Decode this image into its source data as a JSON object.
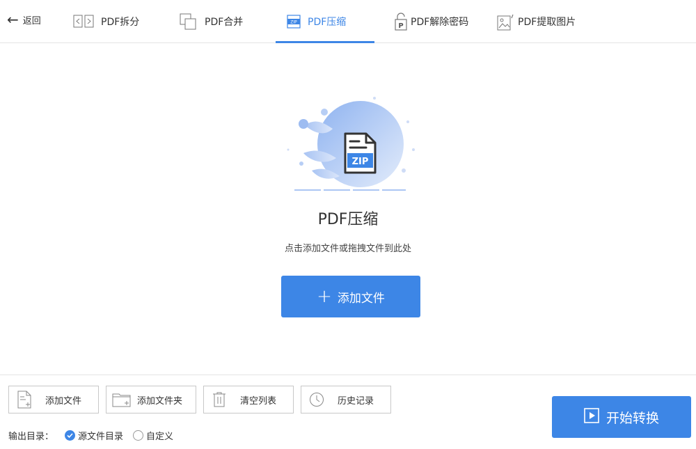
{
  "header": {
    "back_label": "返回",
    "tabs": [
      {
        "id": "split",
        "label": "PDF拆分",
        "icon": "split-icon"
      },
      {
        "id": "merge",
        "label": "PDF合并",
        "icon": "merge-icon"
      },
      {
        "id": "compress",
        "label": "PDF压缩",
        "icon": "zip-icon",
        "active": true
      },
      {
        "id": "unlock",
        "label": "PDF解除密码",
        "icon": "unlock-icon"
      },
      {
        "id": "extract",
        "label": "PDF提取图片",
        "icon": "image-icon"
      }
    ]
  },
  "main": {
    "illustration_badge": "ZIP",
    "title": "PDF压缩",
    "hint": "点击添加文件或拖拽文件到此处",
    "add_button_label": "添加文件"
  },
  "toolbar": {
    "buttons": [
      {
        "id": "add-file",
        "label": "添加文件",
        "icon": "add-file-icon"
      },
      {
        "id": "add-folder",
        "label": "添加文件夹",
        "icon": "add-folder-icon"
      },
      {
        "id": "clear-list",
        "label": "清空列表",
        "icon": "trash-icon"
      },
      {
        "id": "history",
        "label": "历史记录",
        "icon": "clock-icon"
      }
    ]
  },
  "output": {
    "label": "输出目录：",
    "options": [
      {
        "label": "源文件目录",
        "checked": true
      },
      {
        "label": "自定义",
        "checked": false
      }
    ]
  },
  "start_button_label": "开始转换",
  "colors": {
    "accent": "#3d86e6",
    "border": "#c8c8c8",
    "divider": "#e4e4e4"
  }
}
